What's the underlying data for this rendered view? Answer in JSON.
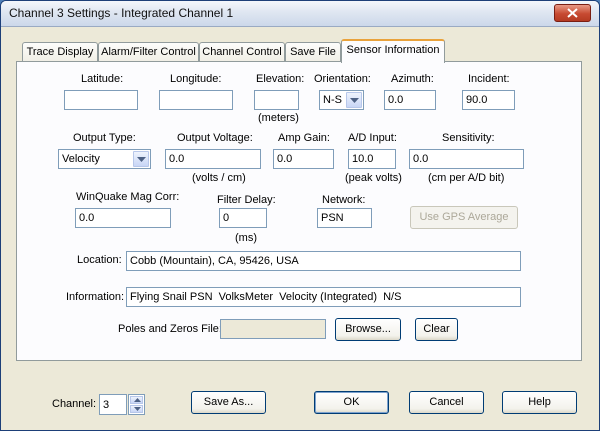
{
  "window": {
    "title": "Channel 3 Settings - Integrated Channel 1"
  },
  "tabs": [
    {
      "label": "Trace Display"
    },
    {
      "label": "Alarm/Filter Control"
    },
    {
      "label": "Channel Control"
    },
    {
      "label": "Save File"
    },
    {
      "label": "Sensor Information"
    }
  ],
  "active_tab": "Sensor Information",
  "sensor": {
    "latitude_label": "Latitude:",
    "latitude_value": "",
    "longitude_label": "Longitude:",
    "longitude_value": "",
    "elevation_label": "Elevation:",
    "elevation_value": "",
    "elevation_unit": "(meters)",
    "orientation_label": "Orientation:",
    "orientation_value": "N-S",
    "azimuth_label": "Azimuth:",
    "azimuth_value": "0.0",
    "incident_label": "Incident:",
    "incident_value": "90.0",
    "output_type_label": "Output Type:",
    "output_type_value": "Velocity",
    "output_voltage_label": "Output Voltage:",
    "output_voltage_value": "0.0",
    "output_voltage_unit": "(volts / cm)",
    "amp_gain_label": "Amp Gain:",
    "amp_gain_value": "0.0",
    "ad_input_label": "A/D Input:",
    "ad_input_value": "10.0",
    "ad_input_unit": "(peak volts)",
    "sensitivity_label": "Sensitivity:",
    "sensitivity_value": "0.0",
    "sensitivity_unit": "(cm per A/D bit)",
    "winquake_label": "WinQuake Mag Corr:",
    "winquake_value": "0.0",
    "filter_delay_label": "Filter Delay:",
    "filter_delay_value": "0",
    "filter_delay_unit": "(ms)",
    "network_label": "Network:",
    "network_value": "PSN",
    "use_gps_label": "Use GPS Average",
    "location_label": "Location:",
    "location_value": "Cobb (Mountain), CA, 95426, USA",
    "information_label": "Information:",
    "information_value": "Flying Snail PSN  VolksMeter  Velocity (Integrated)  N/S",
    "poles_zeros_label": "Poles and Zeros File:",
    "poles_zeros_value": "",
    "browse_label": "Browse...",
    "clear_label": "Clear"
  },
  "footer": {
    "channel_label": "Channel:",
    "channel_value": "3",
    "save_as_label": "Save As...",
    "ok_label": "OK",
    "cancel_label": "Cancel",
    "help_label": "Help"
  },
  "icons": {
    "close": "close-icon",
    "dropdown": "chevron-down-icon",
    "spin_up": "chevron-up-icon",
    "spin_down": "chevron-down-icon"
  },
  "colors": {
    "dialog_face": "#ece9d8",
    "panel": "#fcfcfe",
    "field_border": "#7f9db9",
    "button_border": "#003c74",
    "active_tab_accent": "#e9a23b",
    "close_button": "#c74a31"
  }
}
